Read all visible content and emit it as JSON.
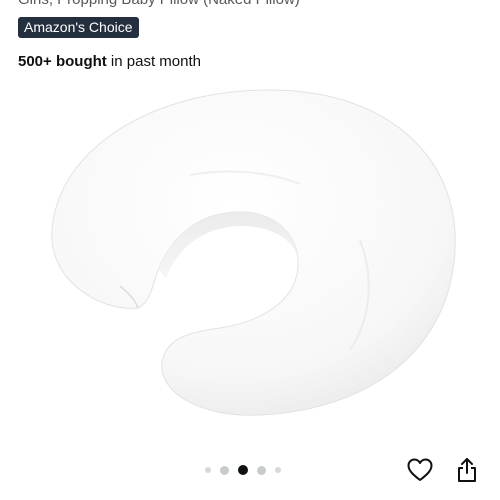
{
  "product": {
    "title_tail": "Girls, Propping Baby Pillow (Naked Pillow)",
    "badge": "Amazon's Choice",
    "bought_count": "500+ bought",
    "bought_suffix": " in past month"
  },
  "carousel": {
    "dot_count": 5,
    "active_index": 2
  },
  "icons": {
    "wishlist": "heart-outline-icon",
    "share": "share-icon"
  },
  "colors": {
    "badge_bg": "#232f3e",
    "text": "#0f1111",
    "muted": "#565959"
  }
}
